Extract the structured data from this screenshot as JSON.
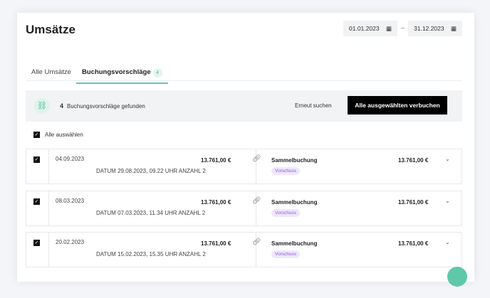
{
  "title": "Umsätze",
  "date_from": "01.01.2023",
  "date_to": "31.12.2023",
  "date_sep": "–",
  "tabs": [
    {
      "label": "Alle Umsätze"
    },
    {
      "label": "Buchungsvorschläge",
      "count": "4"
    }
  ],
  "bar": {
    "count": "4",
    "text": "Buchungsvorschläge gefunden",
    "search_again": "Erneut suchen",
    "book_all": "Alle ausgewählten verbuchen"
  },
  "select_all": "Alle auswählen",
  "rows": [
    {
      "date": "04.09.2023",
      "amount": "13.761,00 €",
      "info": "DATUM 29.08.2023, 09.22 UHR ANZAHL 2",
      "type": "Sammelbuchung",
      "tag": "Vorschuss",
      "amount2": "13.761,00 €"
    },
    {
      "date": "08.03.2023",
      "amount": "13.761,00 €",
      "info": "DATUM 07.03.2023, 11.34 UHR ANZAHL 2",
      "type": "Sammelbuchung",
      "tag": "Vorschuss",
      "amount2": "13.761,00 €"
    },
    {
      "date": "20.02.2023",
      "amount": "13.761,00 €",
      "info": "DATUM 15.02.2023, 15.35 UHR ANZAHL 2",
      "type": "Sammelbuchung",
      "tag": "Vorschuss",
      "amount2": "13.761,00 €"
    }
  ]
}
